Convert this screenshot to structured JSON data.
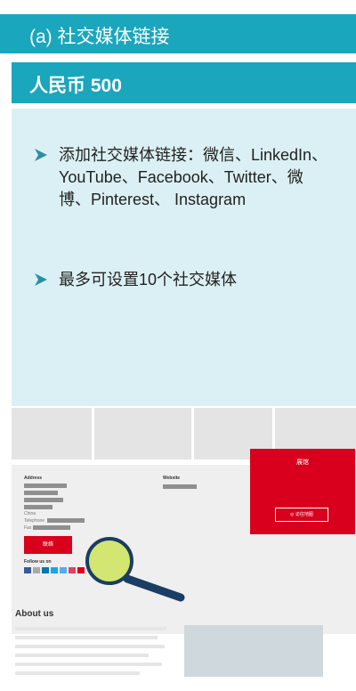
{
  "header": {
    "title": "(a) 社交媒体链接"
  },
  "price": {
    "label": "人民币 500"
  },
  "features": [
    {
      "text": "添加社交媒体链接：微信、LinkedIn、YouTube、Facebook、Twitter、微博、Pinterest、 Instagram"
    },
    {
      "text": "最多可设置10个社交媒体"
    }
  ],
  "screenshot": {
    "address_label": "Address",
    "website_label": "Website",
    "country": "China",
    "telephone_label": "Telephone",
    "fax_label": "Fax",
    "button_label": "联络",
    "follow_label": "Follow us on",
    "booth_title": "展馆",
    "map_button": "◎ 访往地图",
    "about_title": "About us"
  },
  "colors": {
    "accent": "#1aa6bd",
    "panel": "#dbf0f4",
    "red": "#d8001c"
  }
}
